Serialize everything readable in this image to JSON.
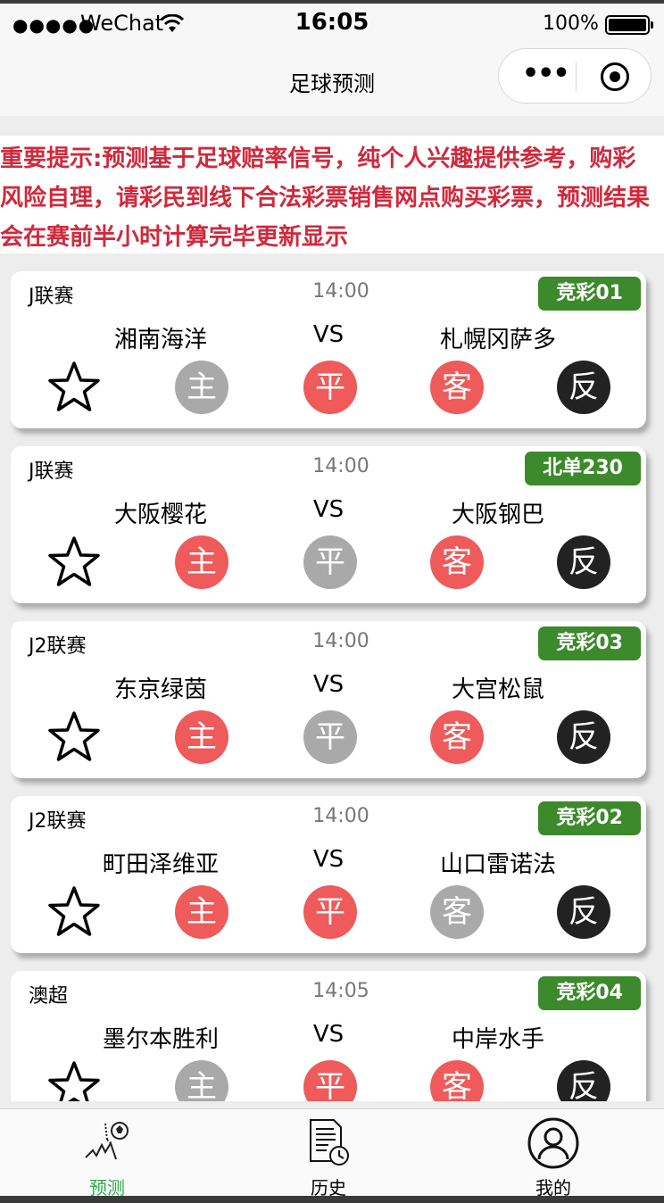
{
  "status_bar": {
    "signal": "●●●●●",
    "carrier": "WeChat",
    "time": "16:05",
    "battery": "100%"
  },
  "nav": {
    "title": "足球预测"
  },
  "notice": {
    "text": "重要提示:预测基于足球赔率信号，纯个人兴趣提供参考，购彩风险自理，请彩民到线下合法彩票销售网点购买彩票，预测结果会在赛前半小时计算完毕更新显示"
  },
  "matches": [
    {
      "league": "J联赛",
      "time": "14:00",
      "tag": "竞彩01",
      "home": "湘南海洋",
      "vs": "VS",
      "away": "札幌冈萨多",
      "picks": [
        {
          "label": "主",
          "state": "grey"
        },
        {
          "label": "平",
          "state": "red"
        },
        {
          "label": "客",
          "state": "red"
        },
        {
          "label": "反",
          "state": "dark"
        }
      ]
    },
    {
      "league": "J联赛",
      "time": "14:00",
      "tag": "北单230",
      "home": "大阪樱花",
      "vs": "VS",
      "away": "大阪钢巴",
      "picks": [
        {
          "label": "主",
          "state": "red"
        },
        {
          "label": "平",
          "state": "grey"
        },
        {
          "label": "客",
          "state": "red"
        },
        {
          "label": "反",
          "state": "dark"
        }
      ]
    },
    {
      "league": "J2联赛",
      "time": "14:00",
      "tag": "竞彩03",
      "home": "东京绿茵",
      "vs": "VS",
      "away": "大宫松鼠",
      "picks": [
        {
          "label": "主",
          "state": "red"
        },
        {
          "label": "平",
          "state": "grey"
        },
        {
          "label": "客",
          "state": "red"
        },
        {
          "label": "反",
          "state": "dark"
        }
      ]
    },
    {
      "league": "J2联赛",
      "time": "14:00",
      "tag": "竞彩02",
      "home": "町田泽维亚",
      "vs": "VS",
      "away": "山口雷诺法",
      "picks": [
        {
          "label": "主",
          "state": "red"
        },
        {
          "label": "平",
          "state": "red"
        },
        {
          "label": "客",
          "state": "grey"
        },
        {
          "label": "反",
          "state": "dark"
        }
      ]
    },
    {
      "league": "澳超",
      "time": "14:05",
      "tag": "竞彩04",
      "home": "墨尔本胜利",
      "vs": "VS",
      "away": "中岸水手",
      "picks": [
        {
          "label": "主",
          "state": "grey"
        },
        {
          "label": "平",
          "state": "red"
        },
        {
          "label": "客",
          "state": "red"
        },
        {
          "label": "反",
          "state": "dark"
        }
      ]
    }
  ],
  "tabs": [
    {
      "label": "预测",
      "icon": "prediction-chart-icon",
      "active": true
    },
    {
      "label": "历史",
      "icon": "history-document-icon",
      "active": false
    },
    {
      "label": "我的",
      "icon": "user-profile-icon",
      "active": false
    }
  ],
  "colors": {
    "accent_red": "#d0293c",
    "tag_green": "#3c8a2b",
    "pick_red": "#ef5a5a",
    "pick_grey": "#a9a9a9",
    "pick_dark": "#222222",
    "tab_active": "#2aae4a"
  }
}
